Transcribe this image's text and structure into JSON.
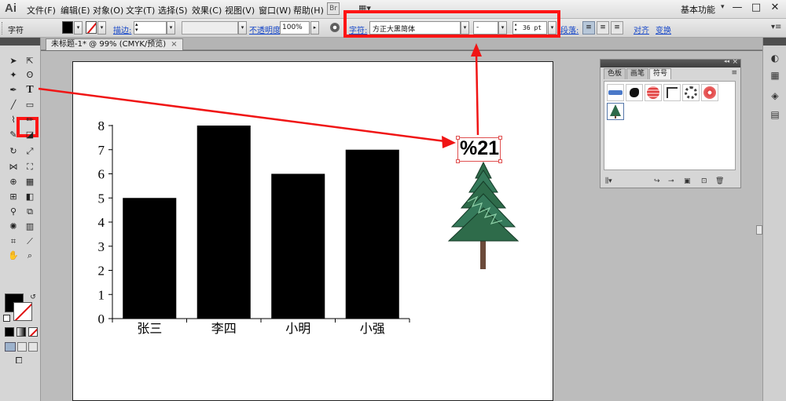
{
  "app": {
    "logo": "Ai"
  },
  "menu": [
    "文件(F)",
    "编辑(E)",
    "对象(O)",
    "文字(T)",
    "选择(S)",
    "效果(C)",
    "视图(V)",
    "窗口(W)",
    "帮助(H)"
  ],
  "workspace": {
    "label": "基本功能",
    "arrow": "▾"
  },
  "window_controls": {
    "minimize": "—",
    "maximize": "□",
    "close": "✕"
  },
  "control_bar": {
    "mode_label": "字符",
    "stroke_label": "描边:",
    "opacity_label": "不透明度:",
    "opacity_value": "100%",
    "char_label": "字符:",
    "font_family": "方正大黑简体",
    "font_style": "-",
    "font_size": "36 pt",
    "paragraph_label": "段落:",
    "align_label": "对齐",
    "transform_label": "变换"
  },
  "document_tab": {
    "title": "未标题-1* @ 99% (CMYK/预览)",
    "close": "×"
  },
  "symbols_panel": {
    "tabs": [
      "色板",
      "画笔",
      "符号"
    ],
    "active_tab": 2,
    "close": "×",
    "collapse": "◂◂",
    "menu_icon": "≡",
    "footer_icons": [
      "symbol-libraries-icon",
      "place-symbol-icon",
      "break-link-icon",
      "symbol-options-icon",
      "new-symbol-icon",
      "delete-symbol-icon"
    ]
  },
  "annotation": {
    "text": "%21",
    "highlight_color": "#ff1414"
  },
  "chart_data": {
    "type": "bar",
    "categories": [
      "张三",
      "李四",
      "小明",
      "小强"
    ],
    "values": [
      5,
      8,
      6,
      7
    ],
    "yticks": [
      0,
      1,
      2,
      3,
      4,
      5,
      6,
      7,
      8
    ],
    "ylim": [
      0,
      8
    ],
    "title": "",
    "xlabel": "",
    "ylabel": "",
    "bar_color": "#000000",
    "grid": false
  }
}
